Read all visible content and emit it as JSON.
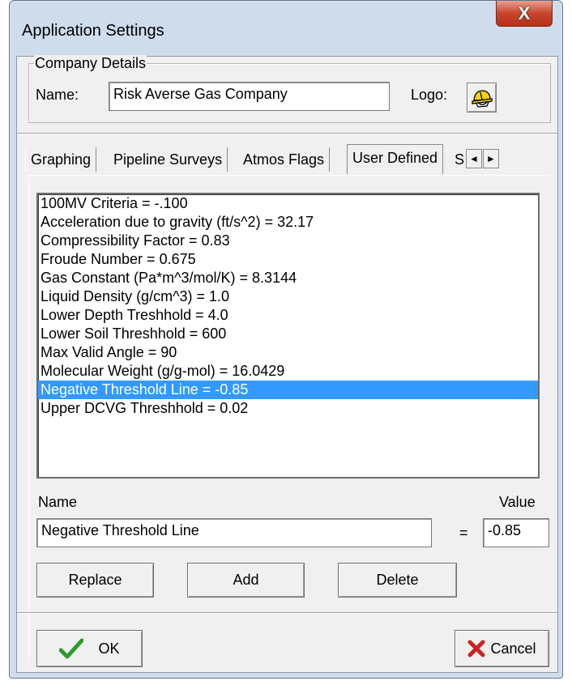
{
  "window": {
    "title": "Application Settings",
    "close_glyph": "X"
  },
  "company": {
    "group_label": "Company Details",
    "name_label": "Name:",
    "name_value": "Risk Averse Gas Company",
    "logo_label": "Logo:"
  },
  "tabs": [
    {
      "label": "Graphing"
    },
    {
      "label": "Pipeline Surveys"
    },
    {
      "label": "Atmos Flags"
    },
    {
      "label": "User Defined",
      "active": true
    },
    {
      "label": "S"
    }
  ],
  "tab_scroll": {
    "left": "◄",
    "right": "►"
  },
  "list": {
    "items": [
      "100MV Criteria = -.100",
      "Acceleration due to gravity (ft/s^2) = 32.17",
      "Compressibility Factor = 0.83",
      "Froude Number = 0.675",
      "Gas Constant (Pa*m^3/mol/K) = 8.3144",
      "Liquid Density (g/cm^3) = 1.0",
      "Lower Depth Treshhold = 4.0",
      "Lower Soil Threshhold = 600",
      "Max Valid Angle = 90",
      "Molecular Weight (g/g-mol) = 16.0429",
      "Negative Threshold Line = -0.85",
      "Upper DCVG Threshhold = 0.02"
    ],
    "selected_index": 10
  },
  "editor": {
    "name_label": "Name",
    "value_label": "Value",
    "equals": "=",
    "name_value": "Negative Threshold Line",
    "value_value": "-0.85"
  },
  "buttons": {
    "replace": "Replace",
    "add": "Add",
    "delete": "Delete",
    "ok": "OK",
    "cancel": "Cancel"
  },
  "colors": {
    "selection": "#3399ff",
    "ok_check": "#2e9a2e",
    "cancel_x": "#cc2222",
    "close_button": "#c8462d"
  }
}
